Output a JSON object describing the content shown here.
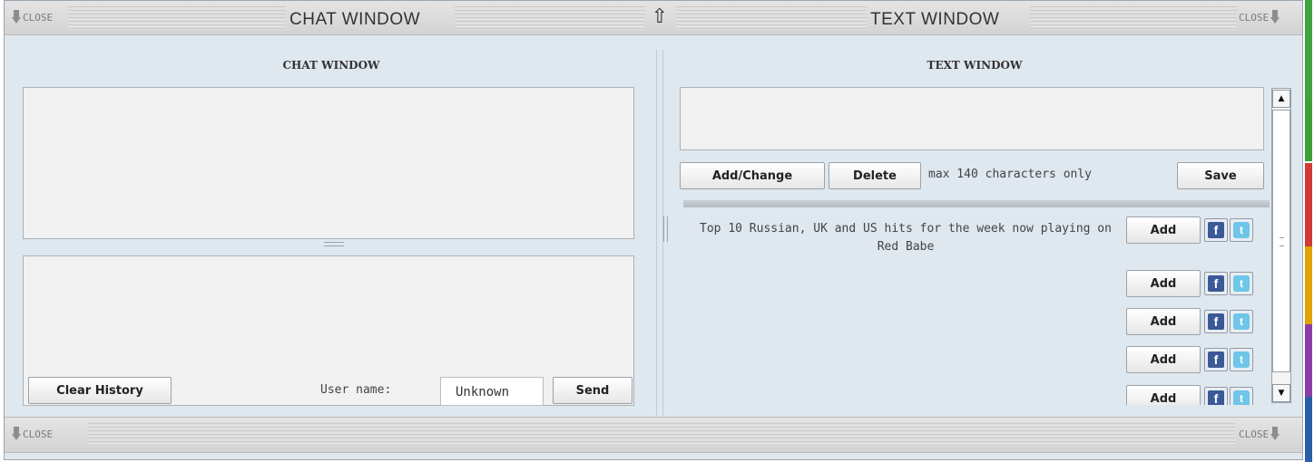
{
  "top_bar": {
    "close_left": "CLOSE",
    "chat_title": "CHAT WINDOW",
    "text_title": "TEXT WINDOW",
    "close_right": "CLOSE"
  },
  "chat_panel": {
    "title": "CHAT WINDOW",
    "clear_history_label": "Clear History",
    "user_name_label": "User name:",
    "user_name_value": "Unknown",
    "send_label": "Send"
  },
  "text_panel": {
    "title": "TEXT WINDOW",
    "add_change_label": "Add/Change",
    "delete_label": "Delete",
    "max_chars_note": "max 140 characters only",
    "save_label": "Save",
    "items": [
      {
        "text": "Top 10 Russian, UK and US hits for the week now playing on Red Babe",
        "add_label": "Add"
      },
      {
        "text": "",
        "add_label": "Add"
      },
      {
        "text": "",
        "add_label": "Add"
      },
      {
        "text": "",
        "add_label": "Add"
      },
      {
        "text": "",
        "add_label": "Add"
      }
    ],
    "facebook_glyph": "f",
    "twitter_glyph": "t"
  },
  "bottom_bar": {
    "close_left": "CLOSE",
    "close_right": "CLOSE"
  },
  "icons": {
    "expand": "up-arrow-icon",
    "close": "down-arrow-icon",
    "share_facebook": "facebook-icon",
    "share_twitter": "twitter-icon"
  },
  "colors": {
    "panel_bg": "#dfe7ef",
    "facebook": "#3b5998",
    "twitter": "#6ec6e8",
    "side_tabs": [
      "#3fa33f",
      "#3aa13a",
      "#d13a3a",
      "#e0a300",
      "#8a3fa8",
      "#2a5fa8"
    ]
  }
}
